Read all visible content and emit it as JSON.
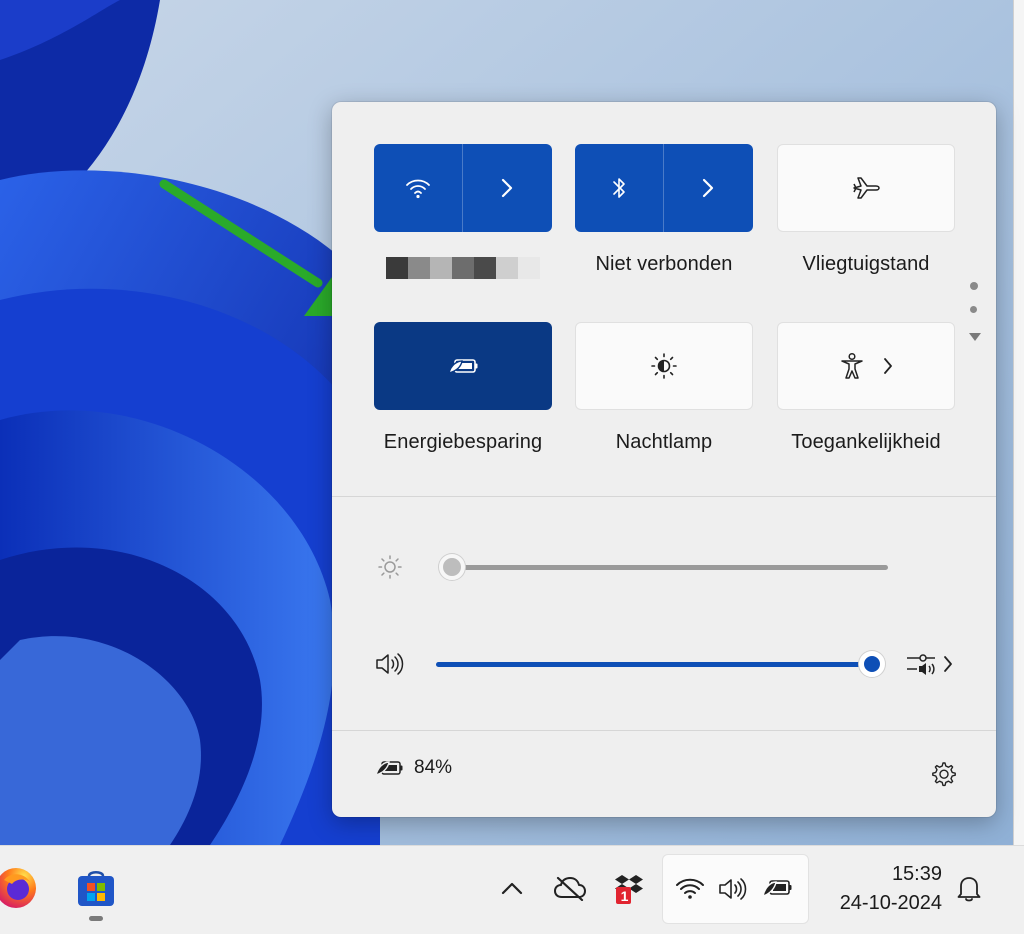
{
  "quick_settings": {
    "tiles": [
      {
        "id": "wifi",
        "label": "",
        "state": "on",
        "icon": "wifi-icon",
        "expandable": true
      },
      {
        "id": "bluetooth",
        "label": "Niet verbonden",
        "state": "on",
        "icon": "bluetooth-icon",
        "expandable": true
      },
      {
        "id": "airplane",
        "label": "Vliegtuigstand",
        "state": "off",
        "icon": "airplane-icon",
        "expandable": false
      },
      {
        "id": "energy_saver",
        "label": "Energiebesparing",
        "state": "on",
        "icon": "energy-saver-icon",
        "expandable": false
      },
      {
        "id": "night_light",
        "label": "Nachtlamp",
        "state": "off",
        "icon": "night-light-icon",
        "expandable": false
      },
      {
        "id": "accessibility",
        "label": "Toegankelijkheid",
        "state": "off",
        "icon": "accessibility-icon",
        "expandable": true
      }
    ],
    "wifi_network_name_redacted": true,
    "page_indicator": {
      "pages": 2,
      "current": 1
    },
    "brightness": {
      "icon": "brightness-icon",
      "level": 0
    },
    "volume": {
      "icon": "speaker-icon",
      "level": 1.0
    },
    "battery": {
      "text": "84%",
      "icon": "battery-leaf-icon"
    },
    "settings_icon": "gear-icon"
  },
  "taskbar": {
    "pinned_apps": [
      {
        "name": "Firefox",
        "icon": "firefox-icon"
      },
      {
        "name": "Microsoft Store",
        "icon": "store-icon"
      }
    ],
    "tray": {
      "chevron_icon": "chevron-up-icon",
      "onedrive_icon": "cloud-offline-icon",
      "dropbox_icon": "dropbox-icon",
      "dropbox_badge": "1",
      "group_icons": [
        "wifi-icon",
        "speaker-icon",
        "battery-leaf-icon"
      ]
    },
    "clock": {
      "time": "15:39",
      "date": "24-10-2024"
    },
    "notifications_icon": "bell-icon"
  },
  "colors": {
    "accent": "#0e4fb6",
    "accent_dark": "#0a3984",
    "arrow": "#2aaa2a",
    "panel_bg": "#efefef"
  }
}
